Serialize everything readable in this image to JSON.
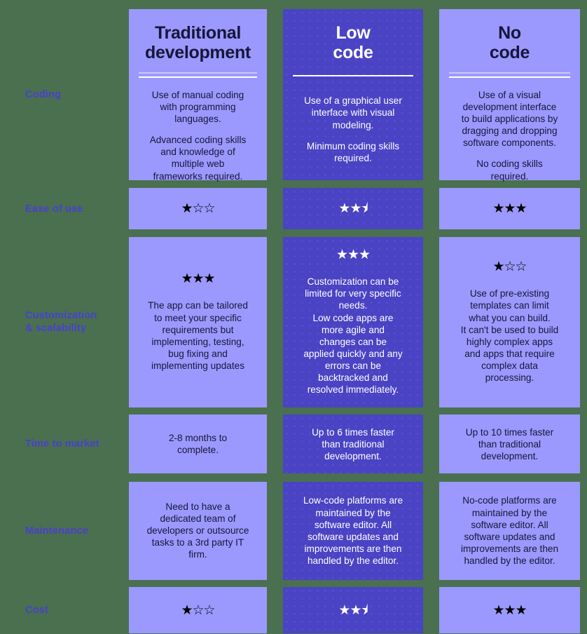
{
  "theme": {
    "background": "#4a7050",
    "column_light": "#9b99fd",
    "column_dark": "#4a43c4",
    "label_color": "#4a3fd0",
    "text_dark": "#16163a",
    "text_light": "#ffffff"
  },
  "columns": [
    {
      "id": "traditional",
      "title": "Traditional\ndevelopment",
      "style": "light"
    },
    {
      "id": "low_code",
      "title": "Low\ncode",
      "style": "dark"
    },
    {
      "id": "no_code",
      "title": "No\ncode",
      "style": "light"
    }
  ],
  "rows": [
    {
      "label": "Coding",
      "cells": [
        {
          "paragraphs": [
            "Use of manual coding\nwith programming\nlanguages.",
            "Advanced coding skills\nand knowledge of\nmultiple web\nframeworks required."
          ]
        },
        {
          "paragraphs": [
            "Use of a graphical user\ninterface with visual\nmodeling.",
            "Minimum coding skills\nrequired."
          ]
        },
        {
          "paragraphs": [
            "Use of a visual\ndevelopment interface\nto build applications by\ndragging and dropping\nsoftware components.",
            "No coding skills\nrequired."
          ]
        }
      ]
    },
    {
      "label": "Ease of use",
      "cells": [
        {
          "stars": "★☆☆",
          "rating": 1,
          "max": 3
        },
        {
          "stars": "★★⯨",
          "rating": 2.5,
          "max": 3
        },
        {
          "stars": "★★★",
          "rating": 3,
          "max": 3
        }
      ]
    },
    {
      "label": "Customization\n& scalability",
      "cells": [
        {
          "stars": "★★★",
          "rating": 3,
          "max": 3,
          "paragraphs": [
            "The app can be tailored\nto meet your specific\nrequirements but\nimplementing, testing,\nbug fixing and\nimplementing updates"
          ]
        },
        {
          "stars": "★★★",
          "rating": 3,
          "max": 3,
          "paragraphs": [
            "Customization can be\nlimited for very specific\nneeds.\nLow code apps are\nmore agile and\nchanges can be\napplied quickly and any\nerrors can be\nbacktracked and\nresolved immediately."
          ]
        },
        {
          "stars": "★☆☆",
          "rating": 1,
          "max": 3,
          "paragraphs": [
            "Use of pre-existing\ntemplates can limit\nwhat you can build.\nIt can't be used to build\nhighly complex apps\nand apps that require\ncomplex data\nprocessing."
          ]
        }
      ]
    },
    {
      "label": "Time to market",
      "cells": [
        {
          "paragraphs": [
            "2-8 months to\ncomplete."
          ]
        },
        {
          "paragraphs": [
            "Up to 6 times faster\nthan traditional\ndevelopment."
          ]
        },
        {
          "paragraphs": [
            "Up to 10 times faster\nthan traditional\ndevelopment."
          ]
        }
      ]
    },
    {
      "label": "Maintenance",
      "cells": [
        {
          "paragraphs": [
            "Need to have a\ndedicated team of\ndevelopers or outsource\ntasks to a 3rd party IT\nfirm."
          ]
        },
        {
          "paragraphs": [
            "Low-code platforms are\nmaintained by the\nsoftware editor. All\nsoftware updates and\nimprovements are then\nhandled by the editor."
          ]
        },
        {
          "paragraphs": [
            "No-code platforms are\nmaintained by the\nsoftware editor. All\nsoftware updates and\nimprovements are then\nhandled by the editor."
          ]
        }
      ]
    },
    {
      "label": "Cost",
      "cells": [
        {
          "stars": "★☆☆",
          "rating": 1,
          "max": 3
        },
        {
          "stars": "★★⯨",
          "rating": 2.5,
          "max": 3
        },
        {
          "stars": "★★★",
          "rating": 3,
          "max": 3
        }
      ]
    }
  ]
}
